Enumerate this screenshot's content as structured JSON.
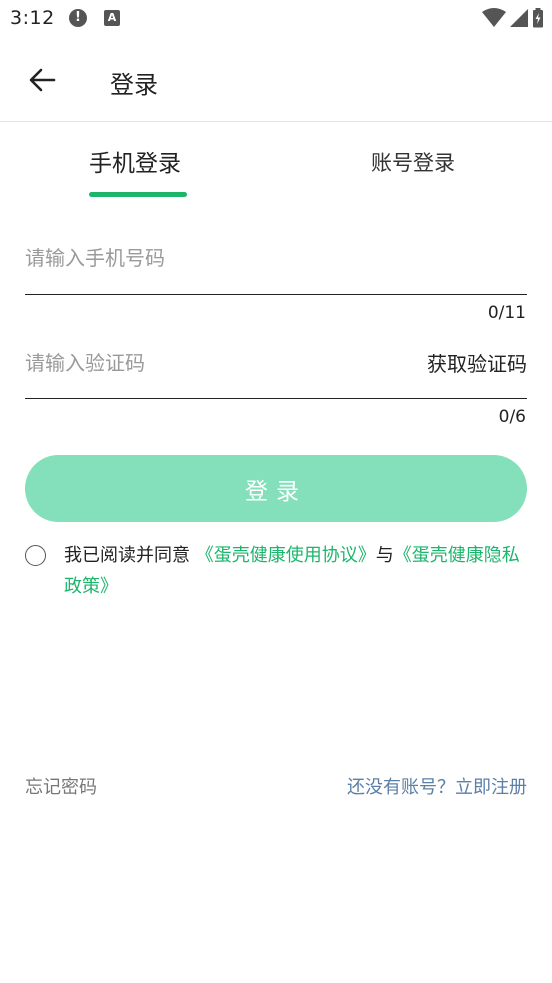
{
  "status_bar": {
    "time": "3:12",
    "alert_glyph": "!",
    "a_glyph": "A",
    "icons": [
      "alert-icon",
      "a-notification-icon",
      "wifi-icon",
      "signal-icon",
      "battery-icon"
    ]
  },
  "app_bar": {
    "title": "登录",
    "back_icon": "arrow-left-icon"
  },
  "tabs": {
    "phone": "手机登录",
    "account": "账号登录",
    "active": "phone"
  },
  "form": {
    "phone_placeholder": "请输入手机号码",
    "phone_value": "",
    "phone_counter": "0/11",
    "code_placeholder": "请输入验证码",
    "code_value": "",
    "code_counter": "0/6",
    "get_code": "获取验证码"
  },
  "login_button": "登录",
  "agreement": {
    "prefix": "我已阅读并同意",
    "user_agreement": "《蛋壳健康使用协议》",
    "joiner": "与",
    "privacy_policy": "《蛋壳健康隐私政策》",
    "checked": false
  },
  "bottom": {
    "forgot": "忘记密码",
    "register": "还没有账号？立即注册"
  },
  "colors": {
    "accent": "#1db56b",
    "button_disabled": "#84e0ba",
    "link_blue": "#5b7fa6"
  }
}
